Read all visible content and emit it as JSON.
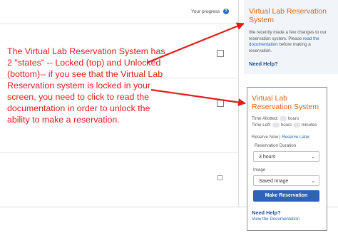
{
  "progress": {
    "label": "Your progress",
    "help_icon": "?"
  },
  "annotation": {
    "text": "The Virtual Lab Reservation System has 2 \"states\" -- Locked (top) and Unlocked (bottom)-- if you see that the Virtual Lab Reservation system is locked in your screen, you need to click to read the documentation in order to unlock the ability to make a reservation.",
    "color": "#e21b1b"
  },
  "locked_panel": {
    "title": "Virtual Lab Reservation System",
    "text_before": "We recently made a few changes to our reservation system. Please ",
    "link": "read the documentation",
    "text_after": " before making a reservation.",
    "need_help": "Need Help?"
  },
  "unlocked_panel": {
    "title": "Virtual Lab Reservation System",
    "time_allotted_label": "Time Allotted:",
    "time_left_label": "Time Left:",
    "hours": "hours",
    "minutes": "minutes",
    "reserve_now": "Reserve Now",
    "separator": "|",
    "reserve_later": "Reserve Later",
    "duration_label": "Reservation Duration",
    "duration_value": "3 hours",
    "image_label": "Image",
    "image_value": "Saved Image",
    "button": "Make Reservation",
    "need_help": "Need Help?",
    "doc_link": "View the Documentation"
  },
  "colors": {
    "title": "#d8671c",
    "button": "#2f63b5",
    "link": "#2563b0"
  }
}
